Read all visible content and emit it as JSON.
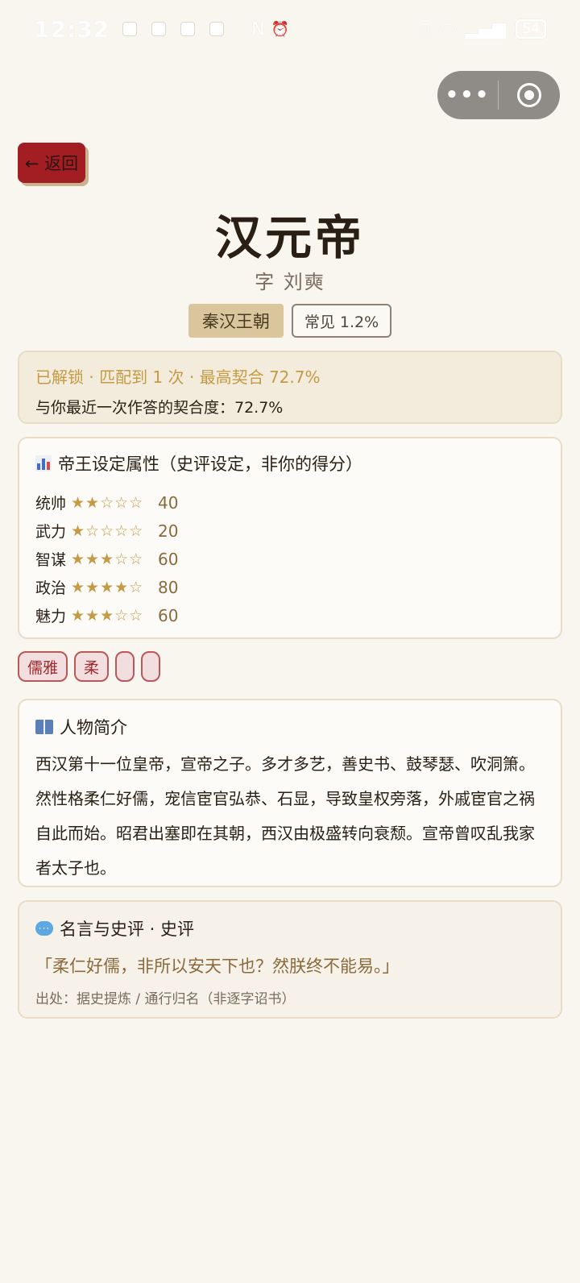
{
  "status_bar": {
    "time": "12:32",
    "battery": "54",
    "app_icons": [
      "app-icon-1",
      "app-icon-2",
      "app-icon-3",
      "app-icon-4"
    ],
    "nfc": "N",
    "alarm": "⏰"
  },
  "capsule": {
    "more": "•••"
  },
  "back_label": "← 返回",
  "emperor": {
    "name": "汉元帝",
    "courtesy": "字 刘奭",
    "dynasty": "秦汉王朝",
    "frequency": "常见 1.2%"
  },
  "unlock": {
    "line1": "已解锁 · 匹配到 1 次 · 最高契合 72.7%",
    "line2": "与你最近一次作答的契合度：72.7%"
  },
  "attributes": {
    "heading": "帝王设定属性（史评设定，非你的得分）",
    "items": [
      {
        "name": "统帅",
        "stars": "★★☆☆☆",
        "value": "40",
        "level": 2
      },
      {
        "name": "武力",
        "stars": "★☆☆☆☆",
        "value": "20",
        "level": 1
      },
      {
        "name": "智谋",
        "stars": "★★★☆☆",
        "value": "60",
        "level": 3
      },
      {
        "name": "政治",
        "stars": "★★★★☆",
        "value": "80",
        "level": 4
      },
      {
        "name": "魅力",
        "stars": "★★★☆☆",
        "value": "60",
        "level": 3
      }
    ]
  },
  "traits": [
    "儒雅",
    "柔",
    "",
    ""
  ],
  "bio": {
    "heading": "人物简介",
    "text": "西汉第十一位皇帝，宣帝之子。多才多艺，善史书、鼓琴瑟、吹洞箫。然性格柔仁好儒，宠信宦官弘恭、石显，导致皇权旁落，外戚宦官之祸自此而始。昭君出塞即在其朝，西汉由极盛转向衰颓。宣帝曾叹乱我家者太子也。"
  },
  "quote": {
    "heading": "名言与史评 · 史评",
    "text": "「柔仁好儒，非所以安天下也？然朕终不能易。」",
    "source": "出处：据史提炼 / 通行归名（非逐字诏书）"
  },
  "colors": {
    "background": "#f9f6ef",
    "accent_gold": "#c49a45",
    "back_red": "#a31e22",
    "chip_red": "#a12a2c"
  }
}
